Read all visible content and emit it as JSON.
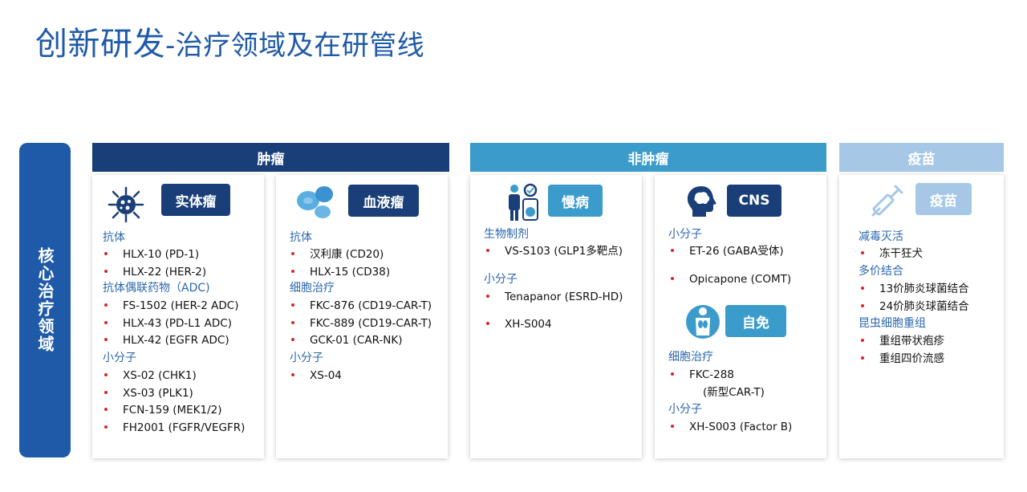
{
  "page": {
    "title_main": "创新研发",
    "title_sub": "-治疗领域及在研管线"
  },
  "side_label": "核心治疗领域",
  "sections": {
    "oncology": "肿瘤",
    "non_oncology": "非肿瘤",
    "vaccine": "疫苗"
  },
  "cards": {
    "solid_tumor": {
      "badge": "实体瘤",
      "cat1": "抗体",
      "items1": [
        "HLX-10 (PD-1)",
        "HLX-22 (HER-2)"
      ],
      "cat2": "抗体偶联药物（ADC)",
      "items2": [
        "FS-1502 (HER-2 ADC)",
        "HLX-43 (PD-L1 ADC)",
        "HLX-42 (EGFR ADC)"
      ],
      "cat3": "小分子",
      "items3": [
        "XS-02 (CHK1)",
        "XS-03 (PLK1)",
        "FCN-159 (MEK1/2)",
        "FH2001 (FGFR/VEGFR)"
      ]
    },
    "blood_tumor": {
      "badge": "血液瘤",
      "cat1": "抗体",
      "items1": [
        "汉利康 (CD20)",
        "HLX-15 (CD38)"
      ],
      "cat2": "细胞治疗",
      "items2": [
        "FKC-876 (CD19-CAR-T)",
        "FKC-889 (CD19-CAR-T)",
        "GCK-01 (CAR-NK)"
      ],
      "cat3": "小分子",
      "items3": [
        "XS-04"
      ]
    },
    "chronic": {
      "badge": "慢病",
      "cat1": "生物制剂",
      "items1": [
        "VS-S103 (GLP1多靶点)"
      ],
      "cat2": "小分子",
      "items2": [
        "Tenapanor (ESRD-HD)",
        "XH-S004"
      ]
    },
    "cns": {
      "badge": "CNS",
      "cat1": "小分子",
      "items1": [
        "ET-26 (GABA受体)",
        "Opicapone (COMT)"
      ],
      "badge2": "自免",
      "cat2": "细胞治疗",
      "items2": [
        "FKC-288",
        "(新型CAR-T)"
      ],
      "cat3": "小分子",
      "items3": [
        "XH-S003 (Factor B)"
      ]
    },
    "vaccine": {
      "badge": "疫苗",
      "cat1": "减毒灭活",
      "items1": [
        "冻干狂犬"
      ],
      "cat2": "多价结合",
      "items2": [
        "13价肺炎球菌结合",
        "24价肺炎球菌结合"
      ],
      "cat3": "昆虫细胞重组",
      "items3": [
        "重组带状疱疹",
        "重组四价流感"
      ]
    }
  },
  "colors": {
    "title": "#1f5aa8",
    "oncology_band": "#1a3e78",
    "non_oncology_band": "#3b9ccb",
    "vaccine_band": "#a6c8e6",
    "category_text": "#2a67ad",
    "bullet": "#d6262c"
  },
  "icons": {
    "solid_tumor": "cancer-cell-icon",
    "blood_tumor": "blood-cells-icon",
    "chronic": "doctor-patient-icon",
    "cns": "brain-head-icon",
    "autoimmune": "body-organs-icon",
    "vaccine": "syringe-icon"
  }
}
